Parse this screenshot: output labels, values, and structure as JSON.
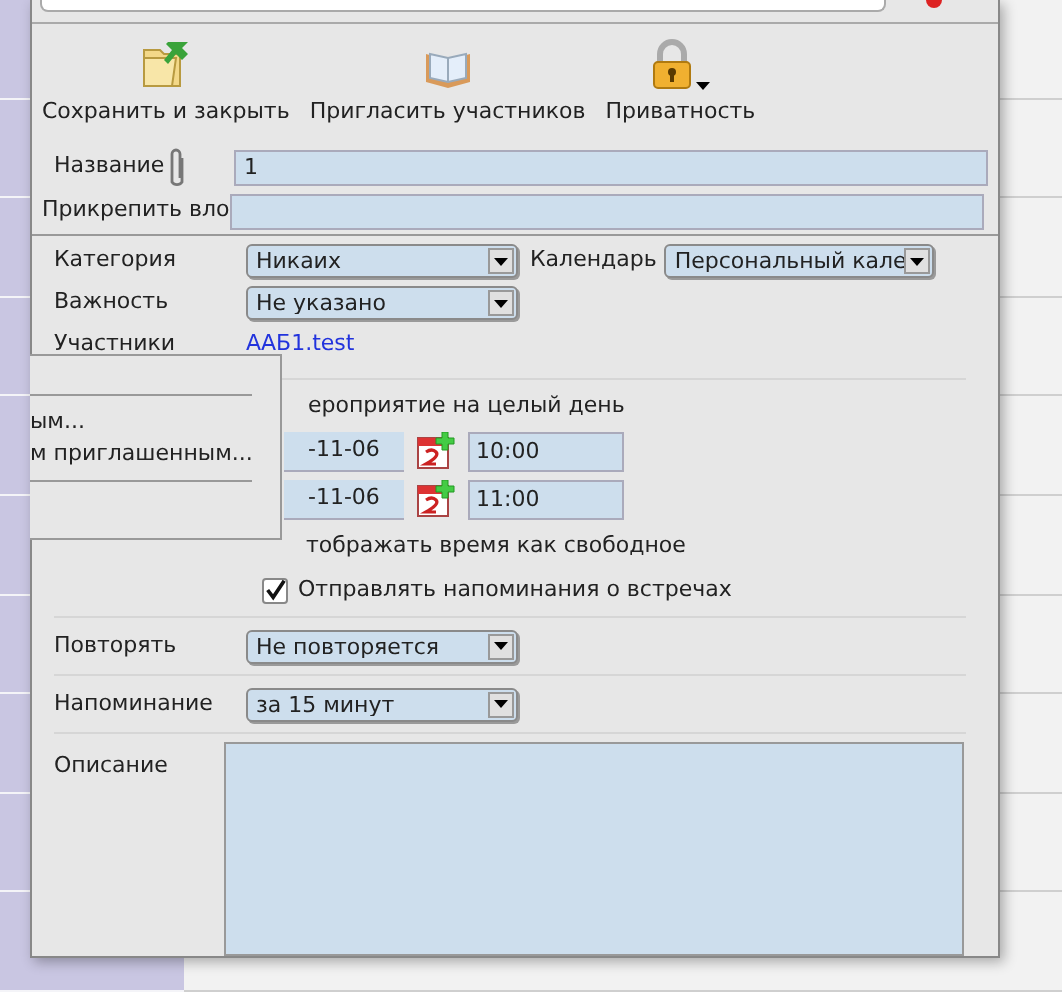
{
  "toolbar": [
    {
      "kind": "save",
      "label": "Сохранить и закрыть"
    },
    {
      "kind": "invite",
      "label": "Пригласить участников"
    },
    {
      "kind": "privacy",
      "label": "Приватность"
    }
  ],
  "form": {
    "title": {
      "label": "Название",
      "value": "1"
    },
    "attach_label": "Прикрепить вло",
    "category": {
      "label": "Категория",
      "value": "Никаих"
    },
    "calendar": {
      "label": "Календарь",
      "value": "Персональный кале"
    },
    "importance": {
      "label": "Важность",
      "value": "Не указано"
    },
    "participants": {
      "label": "Участники",
      "value": "ААБ1.test"
    },
    "all_day": {
      "label": "ероприятие на целый день"
    },
    "start": {
      "date": "-11-06",
      "time": "10:00"
    },
    "end": {
      "date": "-11-06",
      "time": "11:00"
    },
    "show_free": {
      "label": "тображать время как свободное"
    },
    "send_reminders": {
      "label": "Отправлять напоминания о встречах",
      "checked": true
    },
    "repeat": {
      "label": "Повторять",
      "value": "Не повторяется"
    },
    "reminder": {
      "label": "Напоминание",
      "value": "за 15 минут"
    },
    "description": {
      "label": "Описание"
    }
  },
  "popup_menu": [
    {
      "kind": "blank"
    },
    {
      "kind": "separator"
    },
    {
      "kind": "item",
      "label": "ым..."
    },
    {
      "kind": "item",
      "label": "м приглашенным..."
    },
    {
      "kind": "separator"
    },
    {
      "kind": "blank"
    }
  ]
}
